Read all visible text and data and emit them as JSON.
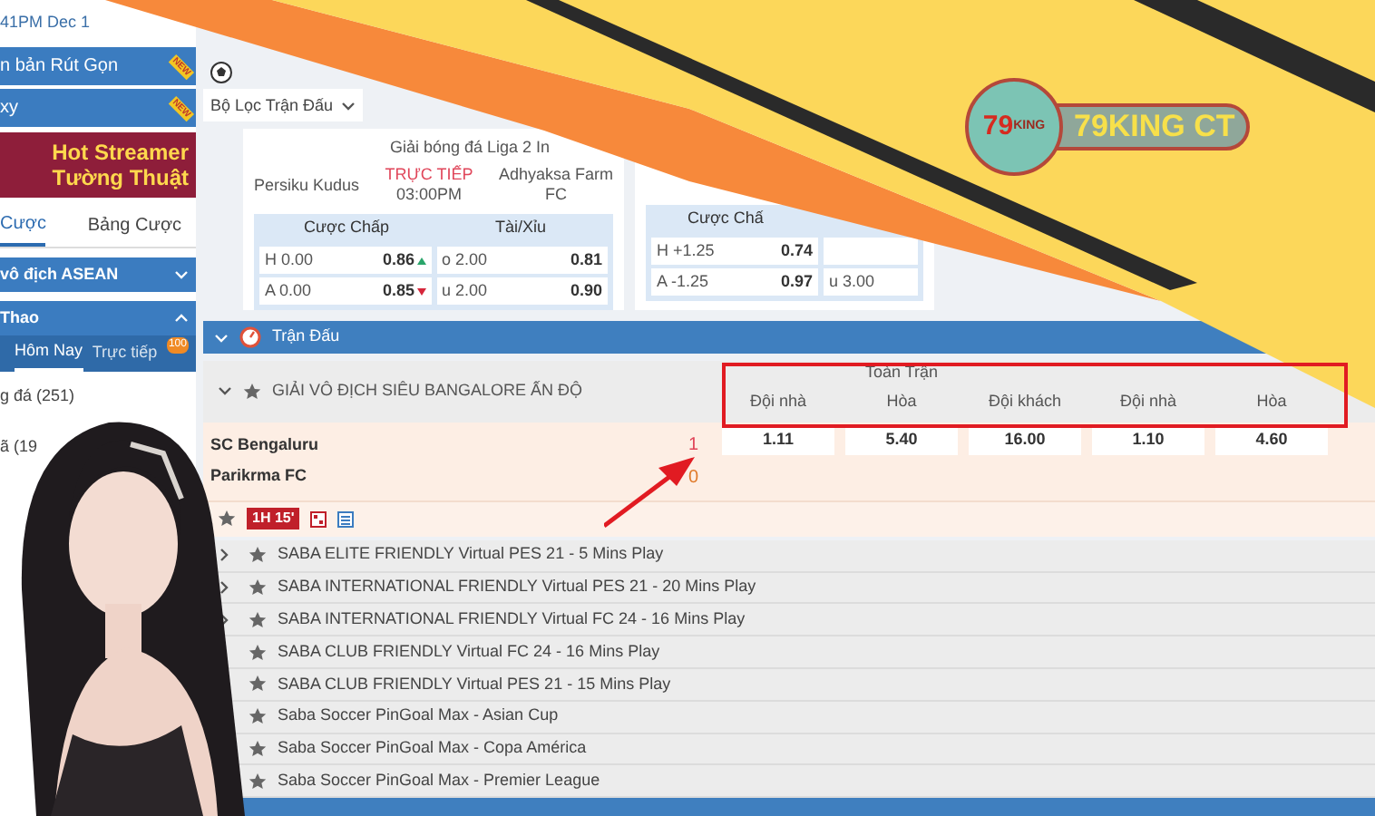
{
  "header": {
    "datetime": "41PM Dec 1"
  },
  "sidebar": {
    "banners": [
      {
        "label": "n bản Rút Gọn",
        "badge": "NEW"
      },
      {
        "label": "xy",
        "badge": "NEW"
      }
    ],
    "promo": {
      "line1": "Hot Streamer",
      "line2": "Tường Thuật"
    },
    "tabs": [
      {
        "label": "Cược",
        "selected": true
      },
      {
        "label": "Bảng Cược",
        "selected": false
      }
    ],
    "sections": [
      {
        "label": "vô địch ASEAN",
        "expanded": false
      },
      {
        "label": "Thao",
        "expanded": true
      }
    ],
    "sport_tabs": [
      {
        "label": "Hôm Nay",
        "selected": true
      },
      {
        "label": "Trực tiếp",
        "selected": false,
        "badge": "100"
      }
    ],
    "sports": [
      "g đá (251)",
      "ã (19"
    ]
  },
  "filter": {
    "label": "Bộ Lọc Trận Đấu"
  },
  "featured": {
    "league": "Giải bóng đá Liga 2 In",
    "home": "Persiku Kudus",
    "status": "TRỰC TIẾP",
    "time": "03:00PM",
    "away": [
      "Adhyaksa Farm",
      "FC"
    ],
    "markets": [
      "Cược Chấp",
      "Tài/Xỉu"
    ],
    "rows": [
      {
        "handicap": "H 0.00",
        "handicap_odds": "0.86",
        "rising": true,
        "total": "o 2.00",
        "total_odds": "0.81"
      },
      {
        "handicap": "A 0.00",
        "handicap_odds": "0.85",
        "rising": false,
        "total": "u 2.00",
        "total_odds": "0.90"
      }
    ]
  },
  "featured_2": {
    "market": "Cược Chấ",
    "rows": [
      {
        "handicap": "H +1.25",
        "handicap_odds": "0.74"
      },
      {
        "handicap": "A -1.25",
        "handicap_odds": "0.97",
        "total": "u 3.00"
      }
    ]
  },
  "matches": {
    "title": "Trận Đấu",
    "league": "GIẢI VÔ ĐỊCH SIÊU BANGALORE ẤN ĐỘ",
    "group_header": "Toàn Trận",
    "columns": [
      "Đội nhà",
      "Hòa",
      "Đội khách",
      "Đội nhà",
      "Hòa"
    ],
    "match": {
      "home": "SC Bengaluru",
      "away": "Parikrma FC",
      "home_score": "1",
      "away_score": "0",
      "odds": [
        "1.11",
        "5.40",
        "16.00",
        "1.10",
        "4.60"
      ],
      "period": "1H 15'"
    },
    "leagues": [
      {
        "name": "SABA ELITE FRIENDLY Virtual PES 21 - 5 Mins Play",
        "expandable": true
      },
      {
        "name": "SABA INTERNATIONAL FRIENDLY Virtual PES 21 - 20 Mins Play",
        "expandable": true
      },
      {
        "name": "SABA INTERNATIONAL FRIENDLY Virtual FC 24 - 16 Mins Play",
        "expandable": true
      },
      {
        "name": "SABA CLUB FRIENDLY Virtual FC 24 - 16 Mins Play",
        "expandable": false
      },
      {
        "name": "SABA CLUB FRIENDLY Virtual PES 21 - 15 Mins Play",
        "expandable": false
      },
      {
        "name": "Saba Soccer PinGoal Max - Asian Cup",
        "expandable": false
      },
      {
        "name": "Saba Soccer PinGoal Max - Copa América",
        "expandable": false
      },
      {
        "name": "Saba Soccer PinGoal Max - Premier League",
        "expandable": false
      }
    ]
  },
  "logo": {
    "badge_number": "79",
    "badge_word": "KING",
    "name": "79KING CT"
  }
}
